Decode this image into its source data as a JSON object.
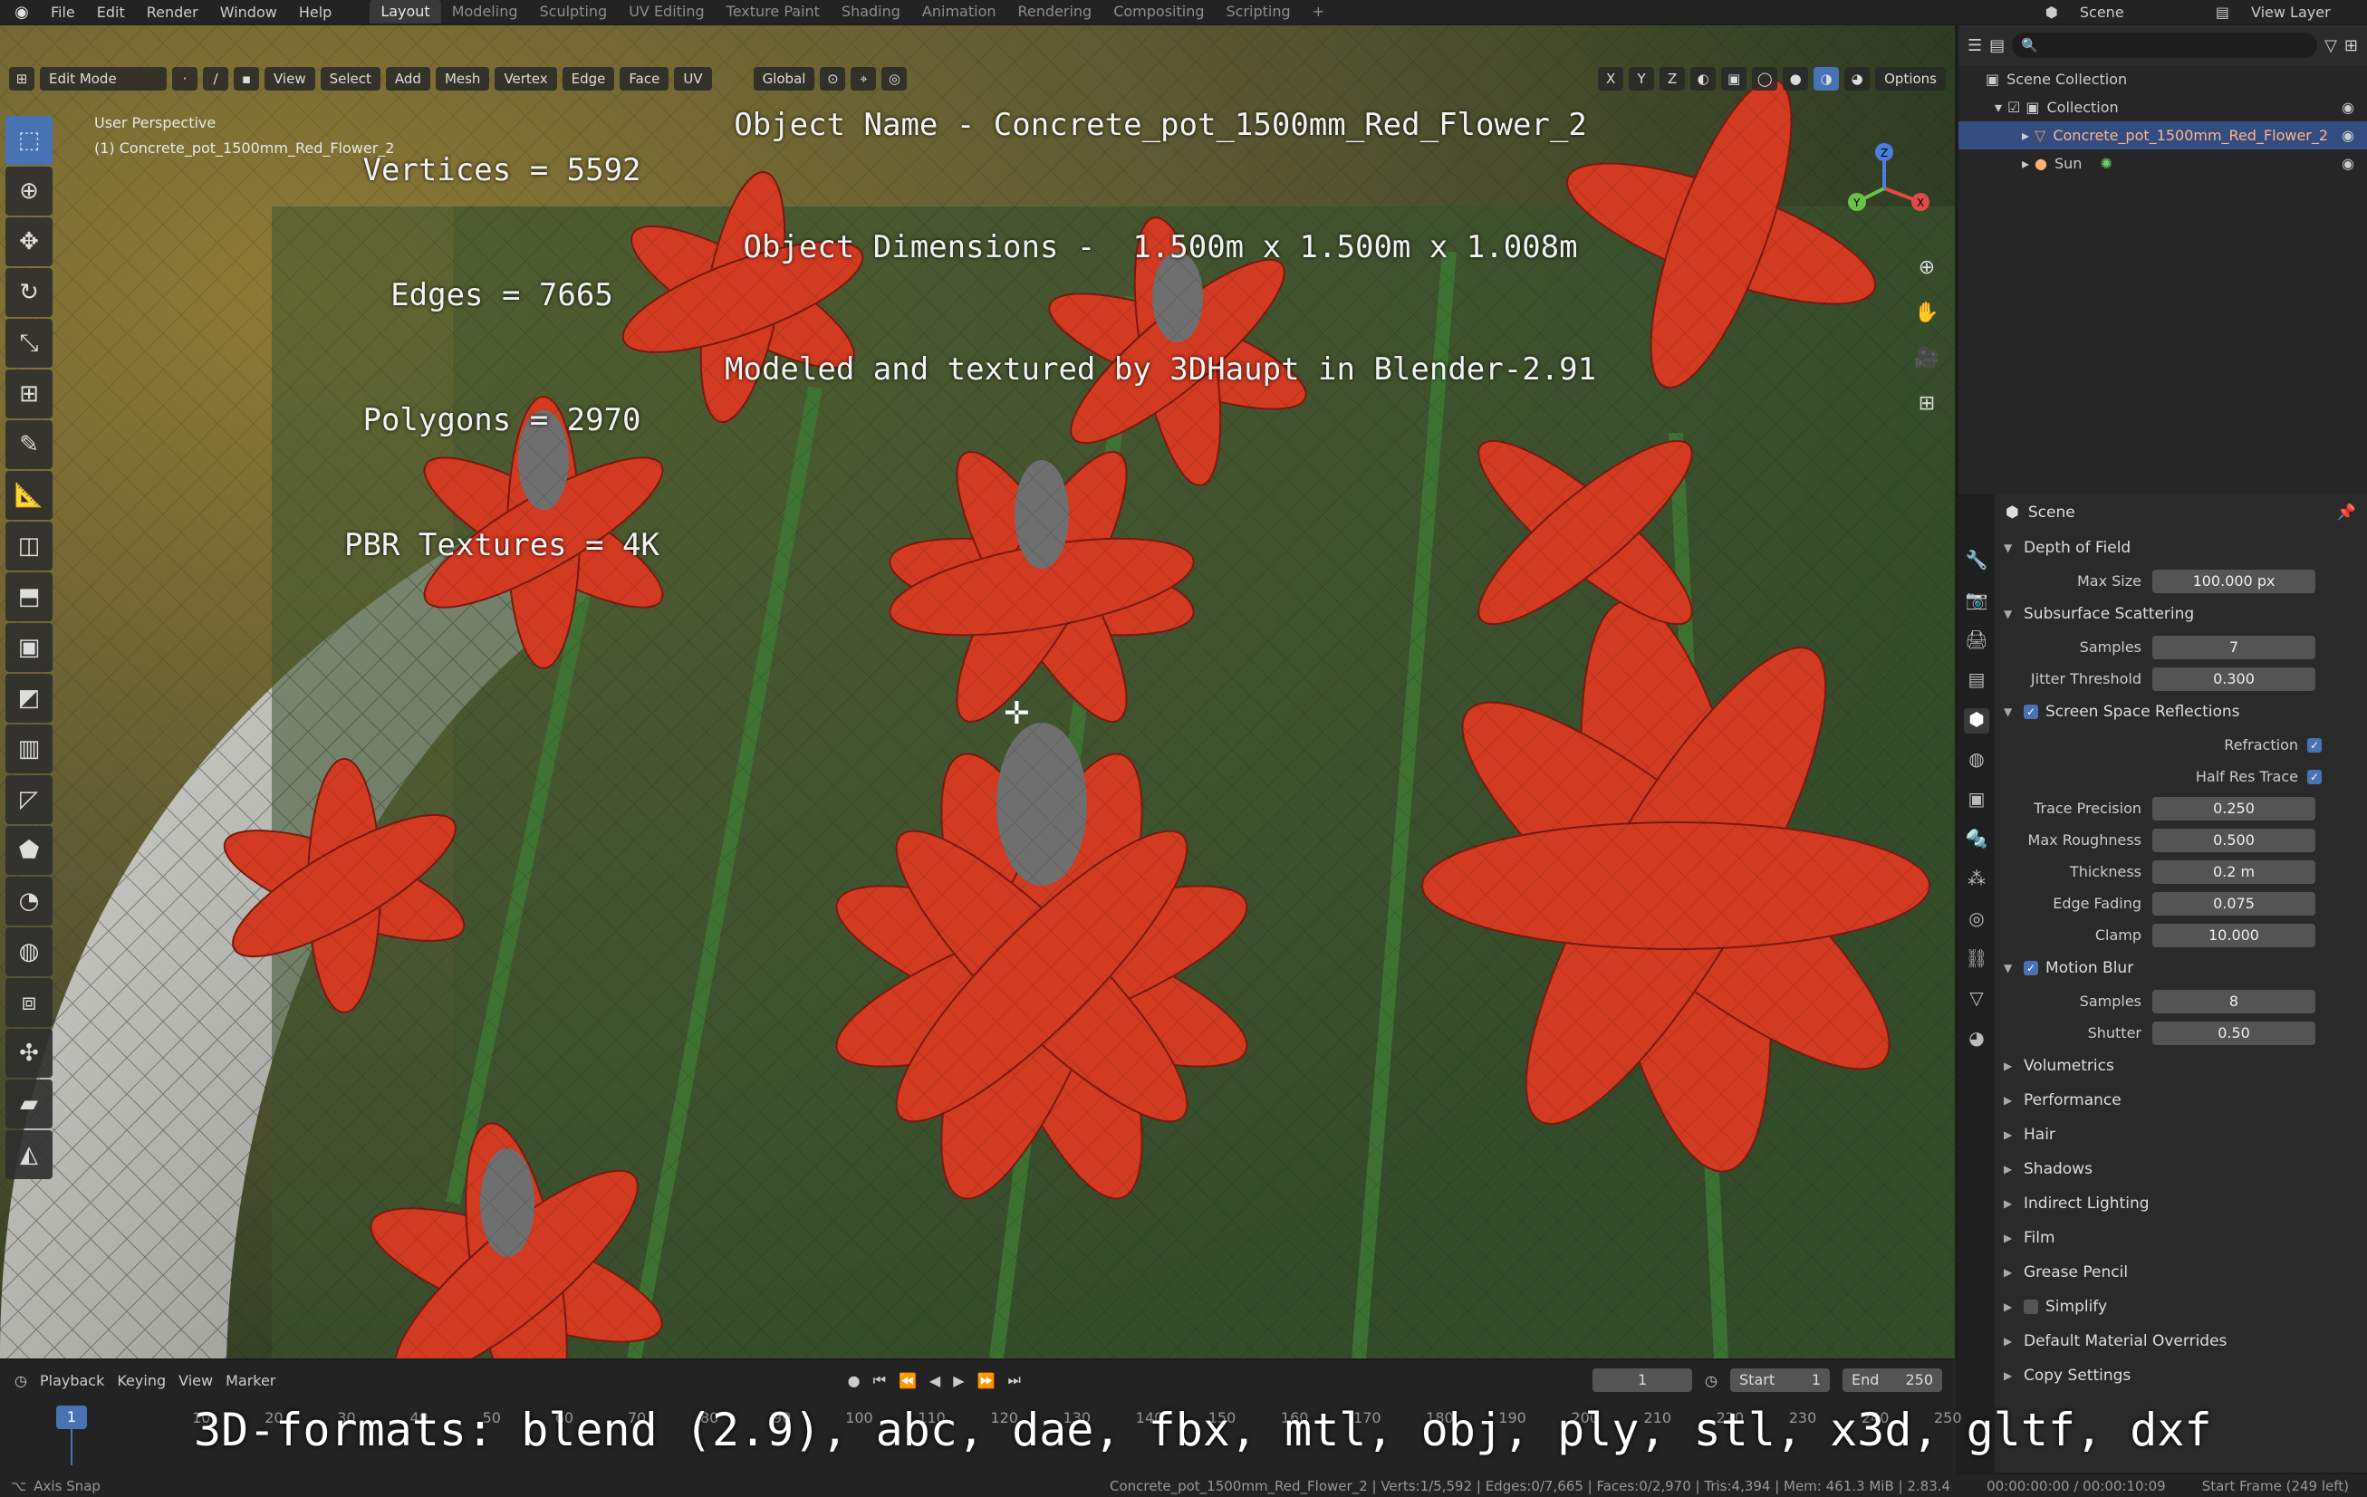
{
  "topbar": {
    "menus": [
      "File",
      "Edit",
      "Render",
      "Window",
      "Help"
    ],
    "workspaces": [
      "Layout",
      "Modeling",
      "Sculpting",
      "UV Editing",
      "Texture Paint",
      "Shading",
      "Animation",
      "Rendering",
      "Compositing",
      "Scripting"
    ],
    "active_workspace": "Layout",
    "add_workspace": "+",
    "scene_label": "Scene",
    "view_layer_label": "View Layer"
  },
  "viewport": {
    "mode": "Edit Mode",
    "menus": [
      "View",
      "Select",
      "Add",
      "Mesh",
      "Vertex",
      "Edge",
      "Face",
      "UV"
    ],
    "orientation": "Global",
    "axes": [
      "X",
      "Y",
      "Z"
    ],
    "options_label": "Options",
    "perspective_label": "User Perspective",
    "selected_object_label": "(1) Concrete_pot_1500mm_Red_Flower_2",
    "stats": [
      "Vertices = 5592",
      "Edges = 7665",
      "Polygons = 2970",
      "PBR Textures = 4K"
    ],
    "info": [
      "Object Name - Concrete_pot_1500mm_Red_Flower_2",
      "Object Dimensions -  1.500m x 1.500m x 1.008m",
      "Modeled and textured by 3DHaupt in Blender-2.91"
    ],
    "gizmo_axes": [
      "X",
      "Y",
      "Z"
    ]
  },
  "outliner": {
    "search_placeholder": "",
    "rows": [
      {
        "label": "Scene Collection",
        "indent": 0,
        "selected": false
      },
      {
        "label": "Collection",
        "indent": 1,
        "selected": false
      },
      {
        "label": "Concrete_pot_1500mm_Red_Flower_2",
        "indent": 2,
        "selected": true
      },
      {
        "label": "Sun",
        "indent": 2,
        "selected": false
      }
    ]
  },
  "properties": {
    "context": "Scene",
    "sections": [
      {
        "title": "Depth of Field",
        "open": true,
        "check": null,
        "rows": [
          {
            "label": "Max Size",
            "value": "100.000 px",
            "fill": 0
          }
        ]
      },
      {
        "title": "Subsurface Scattering",
        "open": true,
        "check": null,
        "rows": [
          {
            "label": "Samples",
            "value": "7",
            "fill": 0
          },
          {
            "label": "Jitter Threshold",
            "value": "0.300",
            "fill": 0.3
          }
        ]
      },
      {
        "title": "Screen Space Reflections",
        "open": true,
        "check": true,
        "rows": [
          {
            "label": "Refraction",
            "checkbox": true
          },
          {
            "label": "Half Res Trace",
            "checkbox": true
          },
          {
            "label": "Trace Precision",
            "value": "0.250",
            "fill": 0.25
          },
          {
            "label": "Max Roughness",
            "value": "0.500",
            "fill": 0.5
          },
          {
            "label": "Thickness",
            "value": "0.2 m",
            "fill": 0
          },
          {
            "label": "Edge Fading",
            "value": "0.075",
            "fill": 0.075
          },
          {
            "label": "Clamp",
            "value": "10.000",
            "fill": 0
          }
        ]
      },
      {
        "title": "Motion Blur",
        "open": true,
        "check": true,
        "rows": [
          {
            "label": "Samples",
            "value": "8",
            "fill": 0
          },
          {
            "label": "Shutter",
            "value": "0.50",
            "fill": 0.5
          }
        ]
      },
      {
        "title": "Volumetrics",
        "open": false,
        "check": null,
        "rows": []
      },
      {
        "title": "Performance",
        "open": false,
        "check": null,
        "rows": []
      },
      {
        "title": "Hair",
        "open": false,
        "check": null,
        "rows": []
      },
      {
        "title": "Shadows",
        "open": false,
        "check": null,
        "rows": []
      },
      {
        "title": "Indirect Lighting",
        "open": false,
        "check": null,
        "rows": []
      },
      {
        "title": "Film",
        "open": false,
        "check": null,
        "rows": []
      },
      {
        "title": "Grease Pencil",
        "open": false,
        "check": null,
        "rows": []
      },
      {
        "title": "Simplify",
        "open": false,
        "check": false,
        "rows": []
      },
      {
        "title": "Default Material Overrides",
        "open": false,
        "check": null,
        "rows": []
      },
      {
        "title": "Copy Settings",
        "open": false,
        "check": null,
        "rows": []
      }
    ]
  },
  "timeline": {
    "menus": [
      "Playback",
      "Keying",
      "View",
      "Marker"
    ],
    "current_frame": "1",
    "start_label": "Start",
    "start": "1",
    "end_label": "End",
    "end": "250",
    "ticks": [
      "10",
      "20",
      "30",
      "40",
      "50",
      "60",
      "70",
      "80",
      "90",
      "100",
      "110",
      "120",
      "130",
      "140",
      "150",
      "160",
      "170",
      "180",
      "190",
      "200",
      "210",
      "220",
      "230",
      "240",
      "250"
    ],
    "formats_caption": "3D-formats: blend (2.9), abc, dae, fbx, mtl, obj, ply, stl, x3d, gltf, dxf"
  },
  "statusbar": {
    "left": "Axis Snap",
    "center": "Concrete_pot_1500mm_Red_Flower_2 | Verts:1/5,592 | Edges:0/7,665 | Faces:0/2,970 | Tris:4,394 | Mem: 461.3 MiB | 2.83.4",
    "time": "00:00:00:00 / 00:00:10:09",
    "right": "Start Frame (249 left)"
  },
  "colors": {
    "accent": "#4772b3",
    "selection_text": "#ffb48a",
    "petal": "#d23a22"
  }
}
